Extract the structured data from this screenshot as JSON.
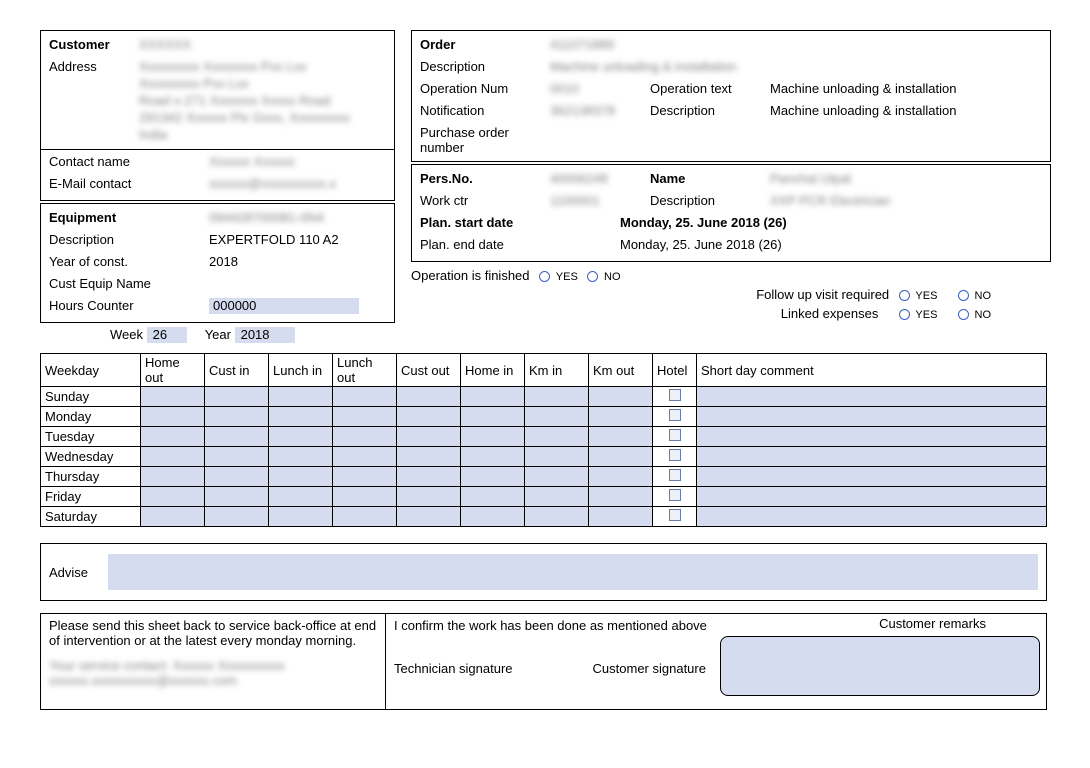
{
  "customer": {
    "title": "Customer",
    "name_value": "XXXXXX",
    "address_label": "Address",
    "address_value": "Xxxxxxxxx Xxxxxxxx Pxx Lxx\nXxxxxxxxx Pxx Lxx\nRoad x-271 Xxxxxxx Xxxxx Road\n291342 Xxxxxx Plx Gxxx, Xxxxxxxxx\nIndia",
    "contact_label": "Contact name",
    "contact_value": "Xxxxxx Xxxxxx",
    "email_label": "E-Mail contact",
    "email_value": "xxxxxx@xxxxxxxxxx.x"
  },
  "order": {
    "title": "Order",
    "order_value": "411071889",
    "description_label": "Description",
    "description_value": "Machine unloading & installation",
    "operation_num_label": "Operation Num",
    "operation_num_value": "0010",
    "operation_text_label": "Operation text",
    "operation_text_value": "Machine unloading & installation",
    "notification_label": "Notification",
    "notification_value": "362138378",
    "notif_description_label": "Description",
    "notif_description_value": "Machine unloading & installation",
    "po_label": "Purchase order number"
  },
  "pers": {
    "pers_no_label": "Pers.No.",
    "pers_no_value": "40006248",
    "name_label": "Name",
    "name_value": "Panchal Utpal",
    "work_ctr_label": "Work ctr",
    "work_ctr_value": "1100001",
    "description_label": "Description",
    "description_value": "XXP PCR Electrician",
    "plan_start_label": "Plan. start date",
    "plan_start_value": "Monday, 25. June 2018 (26)",
    "plan_end_label": "Plan. end date",
    "plan_end_value": "Monday, 25. June 2018 (26)",
    "op_finished_label": "Operation is finished",
    "yes": "YES",
    "no": "NO",
    "follow_up_label": "Follow up visit required",
    "linked_expenses_label": "Linked expenses"
  },
  "equipment": {
    "title": "Equipment",
    "equipment_value": "094428700081-0N4",
    "description_label": "Description",
    "description_value": "EXPERTFOLD 110 A2",
    "year_label": "Year of const.",
    "year_value": "2018",
    "cust_equip_label": "Cust Equip Name",
    "hours_label": "Hours Counter",
    "hours_value": "000000"
  },
  "period": {
    "week_label": "Week",
    "week_value": "26",
    "year_label": "Year",
    "year_value": "2018"
  },
  "timesheet": {
    "headers": [
      "Weekday",
      "Home out",
      "Cust in",
      "Lunch in",
      "Lunch out",
      "Cust out",
      "Home in",
      "Km in",
      "Km out",
      "Hotel",
      "Short day comment"
    ],
    "days": [
      "Sunday",
      "Monday",
      "Tuesday",
      "Wednesday",
      "Thursday",
      "Friday",
      "Saturday"
    ]
  },
  "advise_label": "Advise",
  "signature": {
    "left_text": "Please send this sheet back to service back-office at end of intervention or at the latest every monday morning.",
    "left_blur1": "Your service contact: Xxxxxx Xxxxxxxxxx",
    "left_blur2": "xxxxxx.xxxxxxxxxx@xxxxxx.com",
    "confirm_text": "I confirm the work has been done as mentioned above",
    "tech_sig": "Technician signature",
    "cust_sig": "Customer signature",
    "remarks_label": "Customer remarks"
  }
}
